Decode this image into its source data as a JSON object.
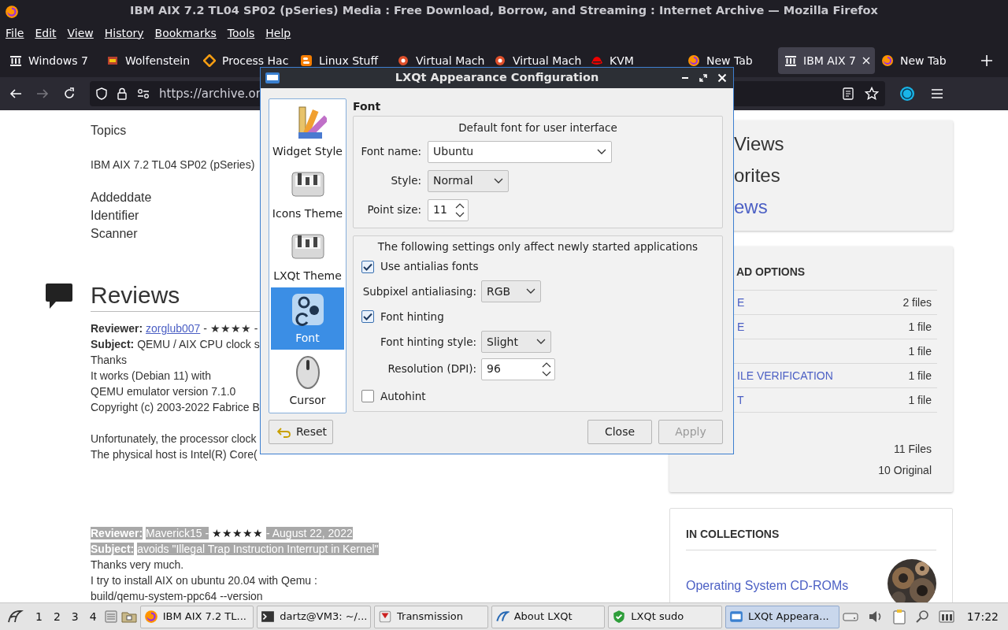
{
  "window": {
    "title": "IBM AIX 7.2 TL04 SP02 (pSeries) Media : Free Download, Borrow, and Streaming : Internet Archive — Mozilla Firefox"
  },
  "menu": [
    "File",
    "Edit",
    "View",
    "History",
    "Bookmarks",
    "Tools",
    "Help"
  ],
  "tabs": [
    {
      "label": "Windows 7",
      "kind": "archive",
      "selected": false
    },
    {
      "label": "Wolfenstein",
      "kind": "game",
      "selected": false
    },
    {
      "label": "Process Hac",
      "kind": "process",
      "selected": false
    },
    {
      "label": "Linux Stuff",
      "kind": "blogger",
      "selected": false
    },
    {
      "label": "Virtual Mach",
      "kind": "vbox",
      "selected": false
    },
    {
      "label": "Virtual Mach",
      "kind": "vbox",
      "selected": false
    },
    {
      "label": "KVM",
      "kind": "redhat",
      "selected": false
    },
    {
      "label": "New Tab",
      "kind": "firefox",
      "selected": false
    },
    {
      "label": "IBM AIX 7",
      "kind": "archive",
      "selected": true
    },
    {
      "label": "New Tab",
      "kind": "firefox",
      "selected": false
    }
  ],
  "address_bar": {
    "url": "https://archive.or"
  },
  "page": {
    "topics_label": "Topics",
    "topics_value": "IBM AIX 7.2 TL04 SP02 (pSeries)",
    "metadata": [
      "Addeddate",
      "Identifier",
      "Scanner"
    ],
    "reviews_heading": "Reviews",
    "reviews": [
      {
        "selected": false,
        "byline": [
          {
            "kind": "label",
            "text": "Reviewer:"
          },
          {
            "kind": "link",
            "text": "zorglub007"
          },
          {
            "kind": "text",
            "text": "- ★★★★ -"
          }
        ],
        "subject": [
          {
            "kind": "label",
            "text": "Subject:"
          },
          {
            "kind": "text",
            "text": "QEMU / AIX CPU clock s"
          }
        ],
        "paragraphs": [
          [
            "Thanks",
            "It works (Debian 11) with",
            "QEMU emulator version 7.1.0",
            "Copyright (c) 2003-2022 Fabrice B"
          ],
          [
            "Unfortunately, the processor clock",
            "The physical host is Intel(R) Core("
          ]
        ]
      },
      {
        "selected": true,
        "byline": [
          {
            "kind": "label",
            "text": "Reviewer:"
          },
          {
            "kind": "text",
            "text": "Maverick15 -"
          },
          {
            "kind": "stars",
            "text": "★★★★★"
          },
          {
            "kind": "text",
            "text": "- August 22, 2022"
          }
        ],
        "subject": [
          {
            "kind": "label",
            "text": "Subject:"
          },
          {
            "kind": "text",
            "text": "avoids \"Illegal Trap Instruction Interrupt in Kernel\""
          }
        ],
        "paragraphs": [
          [
            "Thanks very much.",
            "I try to install AIX on ubuntu 20.04 with Qemu :",
            "build/qemu-system-ppc64 --version"
          ]
        ]
      }
    ]
  },
  "sidebar": {
    "stats": [
      {
        "text": "Views",
        "kind": "plain"
      },
      {
        "text": "orites",
        "kind": "plain"
      },
      {
        "text": "ews",
        "kind": "link"
      }
    ],
    "downloads": {
      "heading": "AD OPTIONS",
      "rows": [
        {
          "label": "E",
          "count": "2 files"
        },
        {
          "label": "E",
          "count": "1 file"
        },
        {
          "count": "1 file"
        },
        {
          "label": "ILE VERIFICATION",
          "count": "1 file"
        },
        {
          "label": "T",
          "count": "1 file"
        }
      ],
      "totals": [
        "11 Files",
        "10 Original"
      ]
    },
    "collections": {
      "heading": "IN COLLECTIONS",
      "items": [
        {
          "label": "Operating System CD-ROMs",
          "kind": "picture"
        }
      ]
    }
  },
  "dialog": {
    "title": "LXQt Appearance Configuration",
    "sidebar": [
      {
        "label": "Widget Style",
        "kind": "palette",
        "selected": false
      },
      {
        "label": "Icons Theme",
        "kind": "toggles",
        "selected": false
      },
      {
        "label": "LXQt Theme",
        "kind": "toggles",
        "selected": false
      },
      {
        "label": "Font",
        "kind": "font",
        "selected": true
      },
      {
        "label": "Cursor",
        "kind": "mouse",
        "selected": false
      }
    ],
    "section_title": "Font",
    "group1": {
      "title": "Default font for user interface",
      "rows": [
        {
          "kind": "combo",
          "label": "Font name:",
          "value": "Ubuntu"
        },
        {
          "kind": "combo",
          "label": "Style:",
          "value": "Normal"
        },
        {
          "kind": "spin",
          "label": "Point size:",
          "value": "11"
        }
      ]
    },
    "group2": {
      "title": "The following settings only affect newly started applications",
      "rows": [
        {
          "kind": "check",
          "label": "Use antialias fonts",
          "checked": true
        },
        {
          "kind": "combo",
          "label": "Subpixel antialiasing:",
          "value": "RGB"
        },
        {
          "kind": "check",
          "label": "Font hinting",
          "checked": true
        },
        {
          "kind": "combo",
          "label": "Font hinting style:",
          "value": "Slight"
        },
        {
          "kind": "spin",
          "label": "Resolution (DPI):",
          "value": "96"
        },
        {
          "kind": "check",
          "label": "Autohint",
          "checked": false
        }
      ]
    },
    "buttons": [
      {
        "label": "Reset",
        "kind": "reset",
        "disabled": false
      },
      {
        "label": "Close",
        "kind": "plain",
        "disabled": false
      },
      {
        "label": "Apply",
        "kind": "plain",
        "disabled": true
      }
    ]
  },
  "taskbar": {
    "desktops": [
      {
        "label": "1",
        "selected": false
      },
      {
        "label": "2",
        "selected": false
      },
      {
        "label": "3",
        "selected": false
      },
      {
        "label": "4",
        "selected": false
      }
    ],
    "tasks": [
      {
        "label": "IBM AIX 7.2 TL...",
        "kind": "firefox",
        "selected": false
      },
      {
        "label": "dartz@VM3: ~/...",
        "kind": "terminal",
        "selected": false
      },
      {
        "label": "Transmission",
        "kind": "transmission",
        "selected": false
      },
      {
        "label": "About LXQt",
        "kind": "lxqt",
        "selected": false
      },
      {
        "label": "LXQt sudo",
        "kind": "shield",
        "selected": false
      },
      {
        "label": "LXQt Appeara...",
        "kind": "window",
        "selected": true
      }
    ],
    "clock": "17:22"
  }
}
